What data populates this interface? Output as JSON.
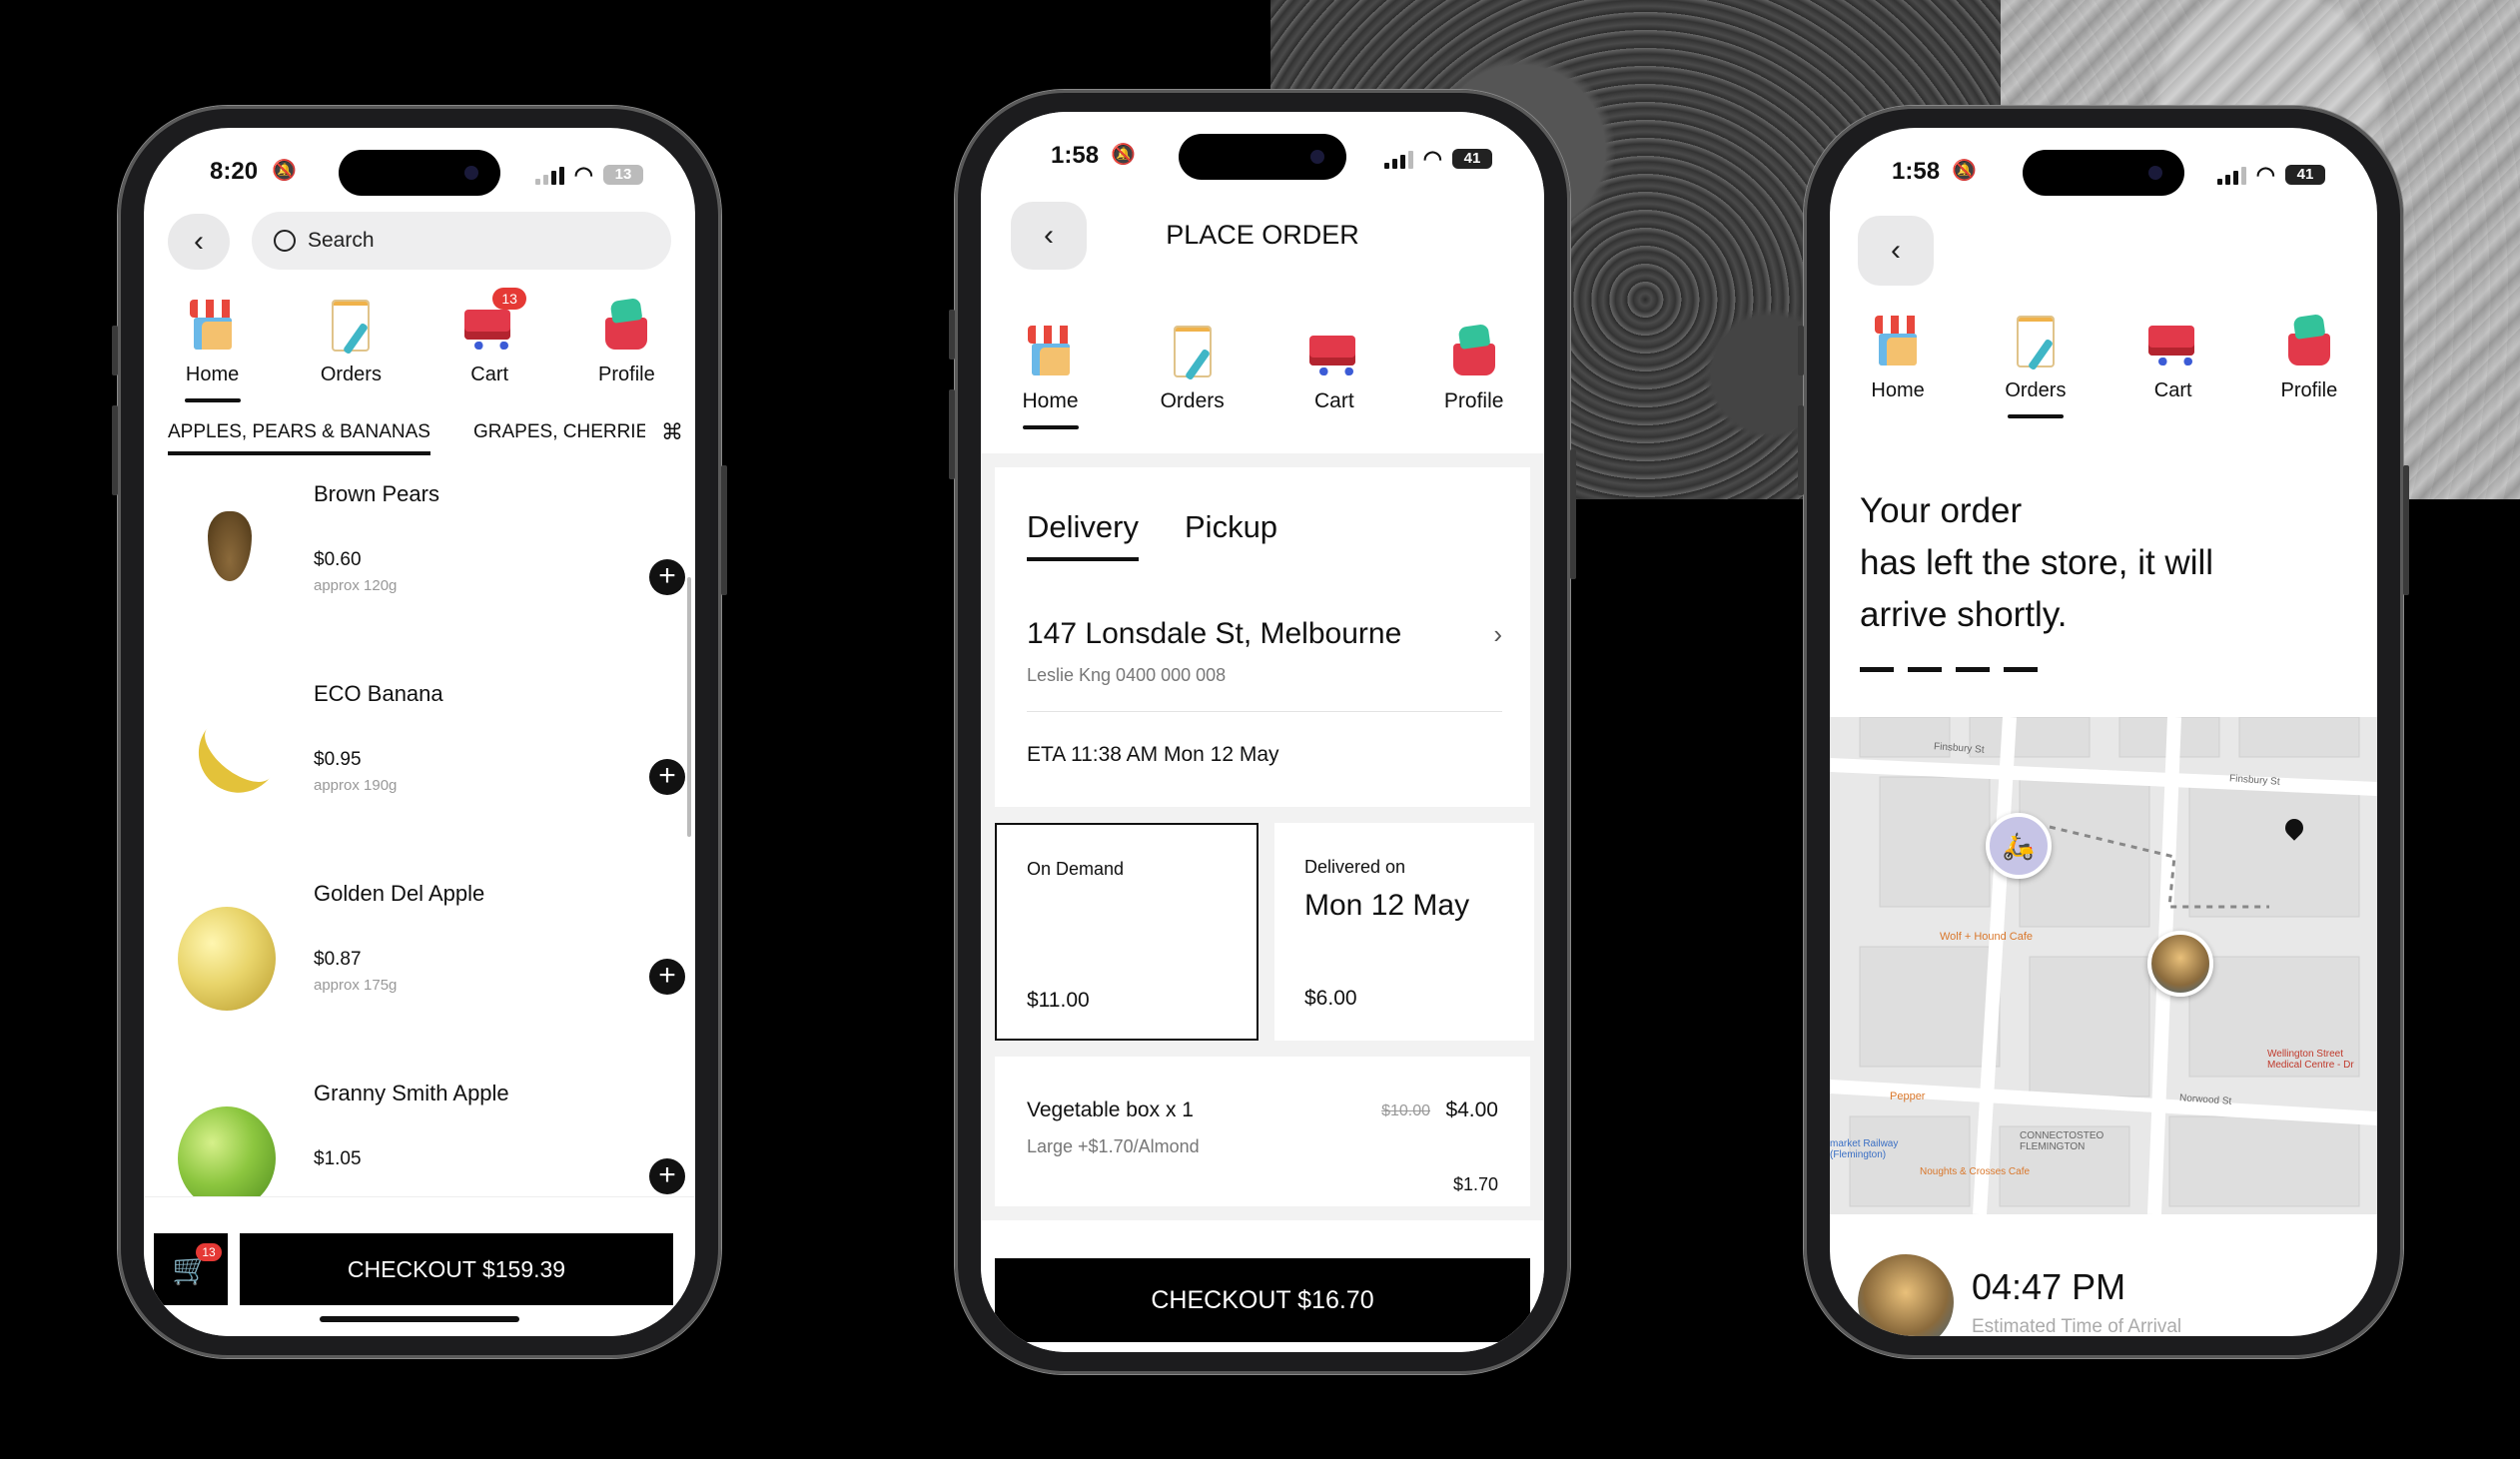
{
  "phone1": {
    "status": {
      "time": "8:20",
      "battery": "13"
    },
    "search": {
      "placeholder": "Search"
    },
    "nav": [
      {
        "label": "Home",
        "icon": "store-icon"
      },
      {
        "label": "Orders",
        "icon": "clipboard-icon"
      },
      {
        "label": "Cart",
        "icon": "cart-icon",
        "badge": "13"
      },
      {
        "label": "Profile",
        "icon": "basket-icon"
      }
    ],
    "categories": [
      {
        "label": "APPLES, PEARS & BANANAS"
      },
      {
        "label": "GRAPES, CHERRIE"
      }
    ],
    "products": [
      {
        "name": "Brown Pears",
        "price": "$0.60",
        "weight": "approx 120g"
      },
      {
        "name": "ECO Banana",
        "price": "$0.95",
        "weight": "approx 190g"
      },
      {
        "name": "Golden Del Apple",
        "price": "$0.87",
        "weight": "approx 175g"
      },
      {
        "name": "Granny Smith Apple",
        "price": "$1.05",
        "weight": ""
      }
    ],
    "cart_badge": "13",
    "checkout_label": "CHECKOUT $159.39"
  },
  "phone2": {
    "status": {
      "time": "1:58",
      "battery": "41"
    },
    "title": "PLACE ORDER",
    "nav": [
      {
        "label": "Home"
      },
      {
        "label": "Orders"
      },
      {
        "label": "Cart"
      },
      {
        "label": "Profile"
      }
    ],
    "tabs": [
      {
        "label": "Delivery"
      },
      {
        "label": "Pickup"
      }
    ],
    "address": {
      "line": "147 Lonsdale St, Melbourne",
      "contact": "Leslie Kng 0400 000 008"
    },
    "eta": "ETA 11:38 AM Mon 12 May",
    "options": [
      {
        "title": "On Demand",
        "date": "",
        "price": "$11.00"
      },
      {
        "title": "Delivered on",
        "date": "Mon 12 May",
        "price": "$6.00"
      }
    ],
    "item": {
      "name": "Vegetable box x 1",
      "old_price": "$10.00",
      "price": "$4.00",
      "detail": "Large +$1.70/Almond",
      "extra": "$1.70"
    },
    "checkout_label": "CHECKOUT $16.70"
  },
  "phone3": {
    "status": {
      "time": "1:58",
      "battery": "41"
    },
    "nav": [
      {
        "label": "Home"
      },
      {
        "label": "Orders"
      },
      {
        "label": "Cart"
      },
      {
        "label": "Profile"
      }
    ],
    "message": {
      "line1": "Your order",
      "line2": "has left the store, it will",
      "line3": "arrive shortly."
    },
    "map": {
      "streets": [
        "Finsbury St",
        "Finsbury St",
        "Norwood St",
        "CONNECTOSTEO FLEMINGTON",
        "Wolf + Hound Cafe",
        "Pepper",
        "Wellington Street Medical Centre - Dr",
        "Noughts & Crosses Cafe",
        "market Railway (Flemington)"
      ]
    },
    "arrival_time": "04:47 PM",
    "arrival_caption": "Estimated Time of Arrival"
  }
}
